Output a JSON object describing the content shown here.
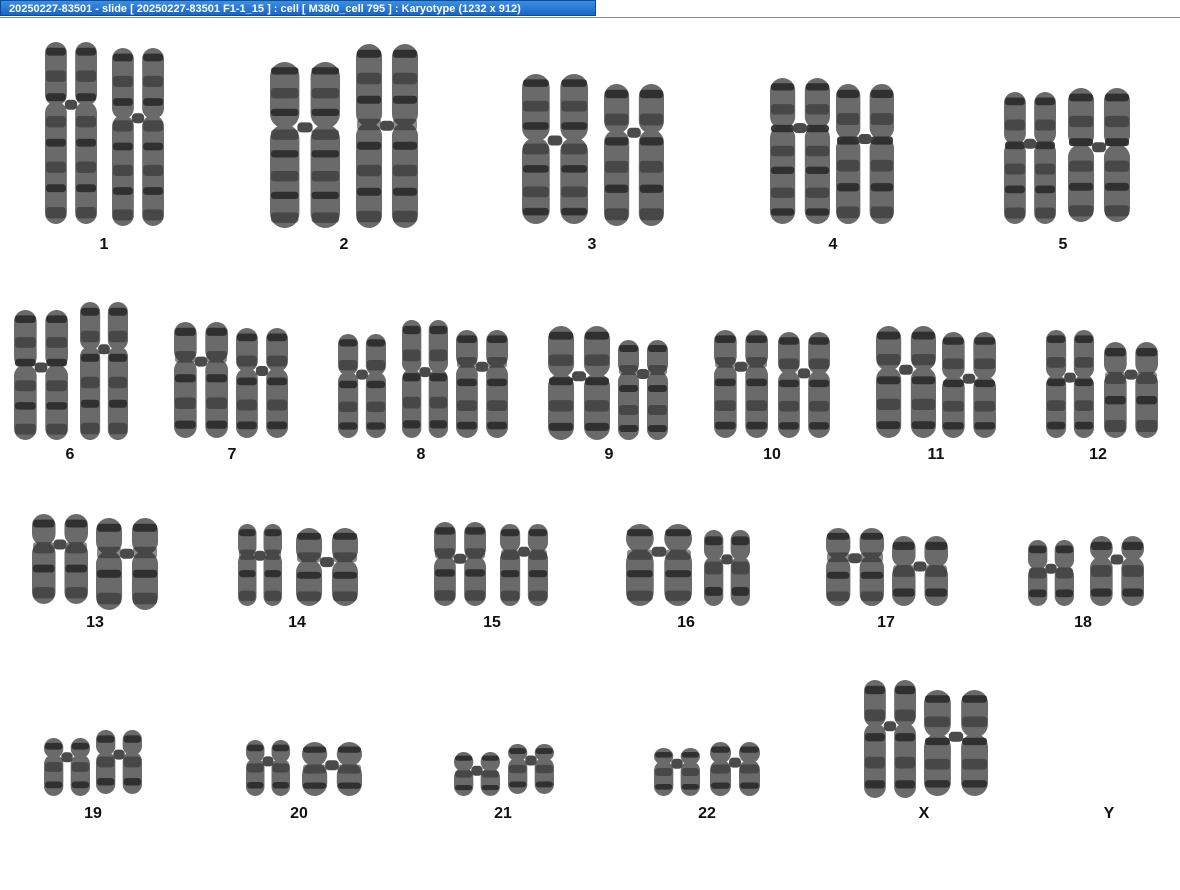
{
  "window": {
    "title": "20250227-83501 - slide [ 20250227-83501 F1-1_15 ] : cell [ M38/0_cell 795 ] : Karyotype  (1232 x 912)"
  },
  "karyotype": {
    "labels": [
      "1",
      "2",
      "3",
      "4",
      "5",
      "6",
      "7",
      "8",
      "9",
      "10",
      "11",
      "12",
      "13",
      "14",
      "15",
      "16",
      "17",
      "18",
      "19",
      "20",
      "21",
      "22",
      "X",
      "Y"
    ]
  },
  "colors": {
    "title_bar": "#1a66c4",
    "chromosome": "#2a2a2a"
  }
}
